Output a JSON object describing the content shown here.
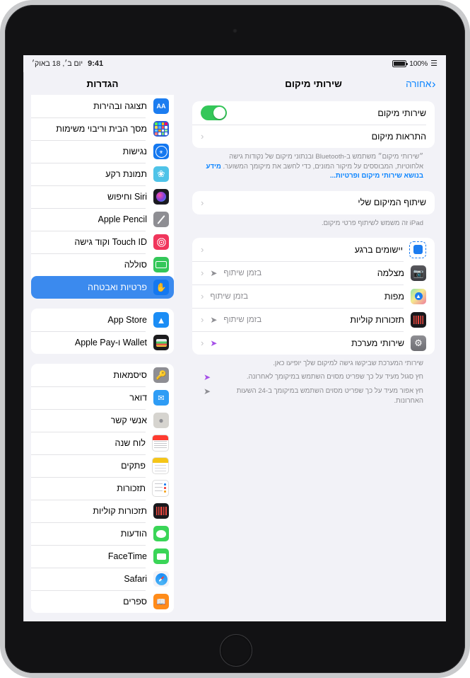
{
  "status_bar": {
    "battery_pct": "100%",
    "wifi_icon": "wifi-icon",
    "time": "9:41",
    "date": "יום ב׳, 18 באוק׳"
  },
  "sidebar": {
    "title": "הגדרות",
    "groups": [
      {
        "items": [
          {
            "label": "תצוגה ובהירות",
            "icon": "display-brightness-icon",
            "glyph": "AA",
            "bg": "#1c7df0",
            "selected": false
          },
          {
            "label": "מסך הבית וריבוי משימות",
            "icon": "home-screen-multitasking-icon",
            "glyph": "",
            "bg": "#2c5fd4",
            "selected": false
          },
          {
            "label": "נגישות",
            "icon": "accessibility-icon",
            "glyph": "♿",
            "bg": "#1478f0",
            "selected": false
          },
          {
            "label": "תמונת רקע",
            "icon": "wallpaper-icon",
            "glyph": "❀",
            "bg": "#4fc3e8",
            "selected": false
          },
          {
            "label": "Siri וחיפוש",
            "icon": "siri-search-icon",
            "glyph": "",
            "bg": "#1a1a20",
            "selected": false
          },
          {
            "label": "Apple Pencil",
            "icon": "apple-pencil-icon",
            "glyph": "✎",
            "bg": "#8e8e93",
            "selected": false
          },
          {
            "label": "Touch ID וקוד גישה",
            "icon": "touch-id-passcode-icon",
            "glyph": "☉",
            "bg": "#f0365c",
            "selected": false
          },
          {
            "label": "סוללה",
            "icon": "battery-icon",
            "glyph": "▭",
            "bg": "#34c759",
            "selected": false
          },
          {
            "label": "פרטיות ואבטחה",
            "icon": "privacy-security-icon",
            "glyph": "✋",
            "bg": "#1478f0",
            "selected": true
          }
        ]
      },
      {
        "items": [
          {
            "label": "App Store",
            "icon": "app-store-icon",
            "glyph": "Ⓐ",
            "bg": "#1b8df5",
            "selected": false
          },
          {
            "label": "Wallet ו‑Apple Pay",
            "icon": "wallet-apple-pay-icon",
            "glyph": "▤",
            "bg": "#1c1c1e",
            "selected": false
          }
        ]
      },
      {
        "items": [
          {
            "label": "סיסמאות",
            "icon": "passwords-icon",
            "glyph": "⚷",
            "bg": "#8e8e93",
            "selected": false
          },
          {
            "label": "דואר",
            "icon": "mail-icon",
            "glyph": "✉",
            "bg": "#2e9cf5",
            "selected": false
          },
          {
            "label": "אנשי קשר",
            "icon": "contacts-icon",
            "glyph": "☻",
            "bg": "#d6d4cf",
            "selected": false
          },
          {
            "label": "לוח שנה",
            "icon": "calendar-icon",
            "glyph": "",
            "bg": "#ffffff",
            "selected": false
          },
          {
            "label": "פתקים",
            "icon": "notes-icon",
            "glyph": "",
            "bg": "#ffffff",
            "selected": false
          },
          {
            "label": "תזכורות",
            "icon": "reminders-icon",
            "glyph": "",
            "bg": "#ffffff",
            "selected": false
          },
          {
            "label": "תזכורות קוליות",
            "icon": "voice-memos-icon",
            "glyph": "",
            "bg": "#19191d",
            "selected": false
          },
          {
            "label": "הודעות",
            "icon": "messages-icon",
            "glyph": "💬",
            "bg": "#3ad557",
            "selected": false
          },
          {
            "label": "FaceTime",
            "icon": "facetime-icon",
            "glyph": "▮",
            "bg": "#3ad557",
            "selected": false
          },
          {
            "label": "Safari",
            "icon": "safari-icon",
            "glyph": "✦",
            "bg": "#f2f2f7",
            "selected": false
          },
          {
            "label": "ספרים",
            "icon": "books-icon",
            "glyph": "📖",
            "bg": "#ff8c1a",
            "selected": false
          }
        ]
      }
    ]
  },
  "detail": {
    "back_label": "אחורה",
    "title": "שירותי מיקום",
    "section1": [
      {
        "label": "שירותי מיקום",
        "control": "toggle",
        "toggle_on": true
      },
      {
        "label": "התראות מיקום",
        "control": "chevron"
      }
    ],
    "footnote1_text": "״שירותי מיקום״ משתמש ב‑Bluetooth ובנתוני מיקום של נקודות גישה אלחוטיות, המבוססים על מיקור המונים, כדי לחשב את מיקומך המשוער. ",
    "footnote1_link": "מידע בנושא שירותי מיקום ופרטיות...",
    "section2": [
      {
        "label": "שיתוף המיקום שלי",
        "control": "chevron"
      }
    ],
    "footnote2": "iPad זה משמש לשיתוף פרטי מיקום.",
    "apps": [
      {
        "label": "יישומים ברגע",
        "icon": "app-clips-icon",
        "value": "",
        "arrow": "none"
      },
      {
        "label": "מצלמה",
        "icon": "camera-icon",
        "value": "בזמן שיתוף",
        "arrow": "gray"
      },
      {
        "label": "מפות",
        "icon": "maps-icon",
        "value": "בזמן שיתוף",
        "arrow": "none"
      },
      {
        "label": "תזכורות קוליות",
        "icon": "voice-memos-icon",
        "value": "בזמן שיתוף",
        "arrow": "gray"
      },
      {
        "label": "שירותי מערכת",
        "icon": "system-services-icon",
        "value": "",
        "arrow": "purple"
      }
    ],
    "footnote3": "שירותי המערכת שביקשו גישה למיקום שלך יופיעו כאן.",
    "legend": [
      {
        "arrow": "purple",
        "text": "חץ סגול מעיד על כך שפריט מסוים השתמש במיקומך לאחרונה."
      },
      {
        "arrow": "gray",
        "text": "חץ אפור מעיד על כך שפריט מסוים השתמש במיקומך ב‑24 השעות האחרונות."
      }
    ]
  },
  "colors": {
    "accent_blue": "#0a84ff",
    "selected_blue": "#3b8aee",
    "toggle_green": "#34c759",
    "purple_arrow": "#a550e8",
    "gray_arrow": "#8e8e93",
    "page_bg": "#f2f2f7"
  }
}
